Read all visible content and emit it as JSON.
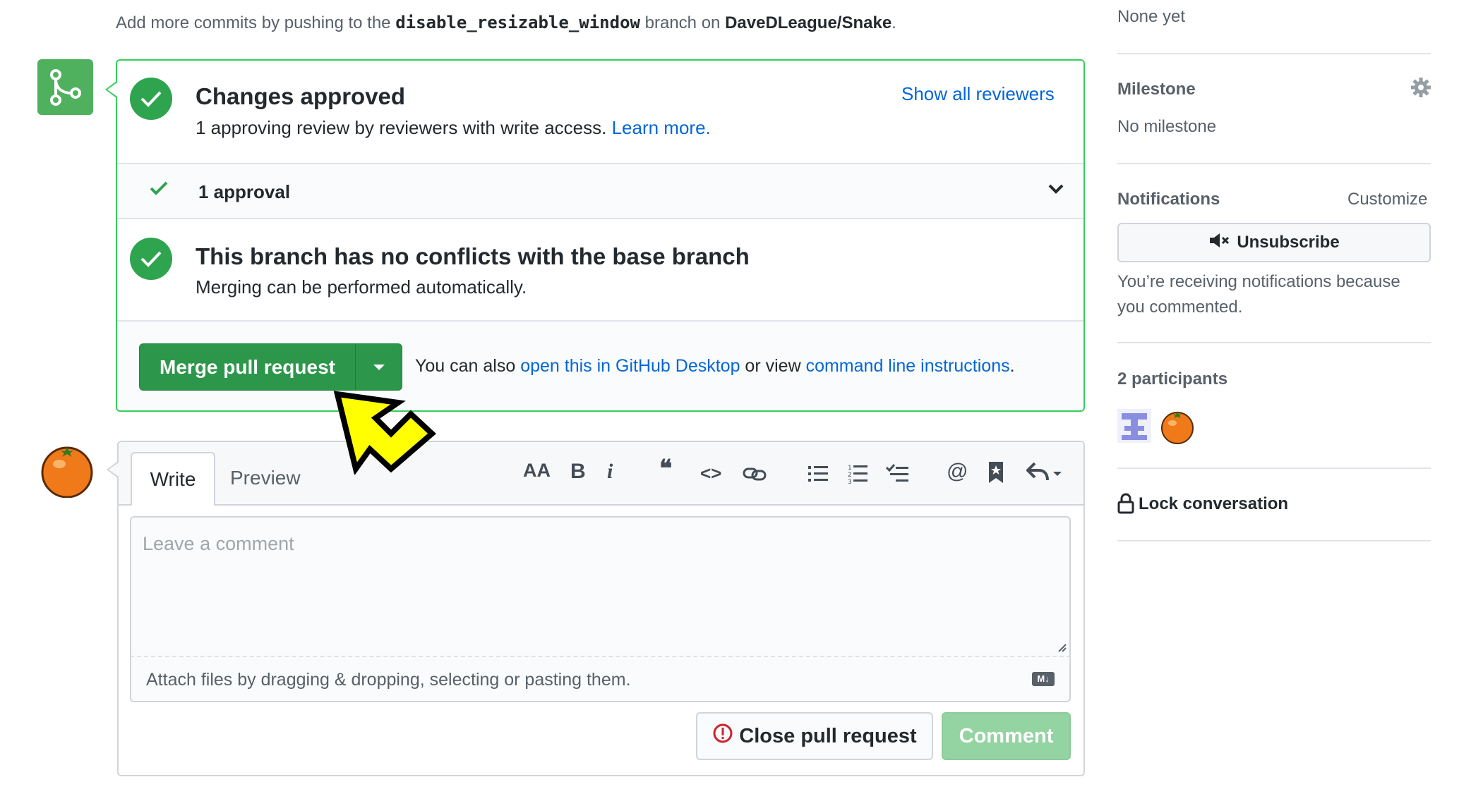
{
  "top": {
    "prefix": "Add more commits by pushing to the ",
    "branch": "disable_resizable_window",
    "middle": " branch on ",
    "repo": "DaveDLeague/Snake",
    "suffix": "."
  },
  "review": {
    "title": "Changes approved",
    "subtitle": "1 approving review by reviewers with write access.",
    "learn_more": "Learn more.",
    "show_reviewers": "Show all reviewers",
    "approval_label": "1 approval"
  },
  "conflicts": {
    "title": "This branch has no conflicts with the base branch",
    "subtitle": "Merging can be performed automatically."
  },
  "merge": {
    "button_label": "Merge pull request",
    "alt_prefix": "You can also ",
    "desktop_link": "open this in GitHub Desktop",
    "alt_middle": " or view ",
    "cli_link": "command line instructions",
    "alt_suffix": "."
  },
  "comment": {
    "tab_write": "Write",
    "tab_preview": "Preview",
    "placeholder": "Leave a comment",
    "attach_text": "Attach files by dragging & dropping, selecting or pasting them.",
    "markdown_badge": "M↓",
    "close_label": "Close pull request",
    "comment_label": "Comment"
  },
  "toolbar": {
    "heading": "AA",
    "bold": "B",
    "italic": "i",
    "quote": "❝",
    "code": "<>",
    "mention": "@"
  },
  "sidebar": {
    "none_yet": "None yet",
    "milestone_title": "Milestone",
    "milestone_value": "No milestone",
    "notifications_title": "Notifications",
    "customize": "Customize",
    "unsubscribe": "Unsubscribe",
    "notif_line1": "You’re receiving notifications because",
    "notif_line2": "you commented.",
    "participants": "2 participants",
    "lock": "Lock conversation"
  },
  "colors": {
    "success": "#2ea44f",
    "merge_button": "#2c974b",
    "link": "#0366d6",
    "annotation_arrow": "#ffff00"
  }
}
